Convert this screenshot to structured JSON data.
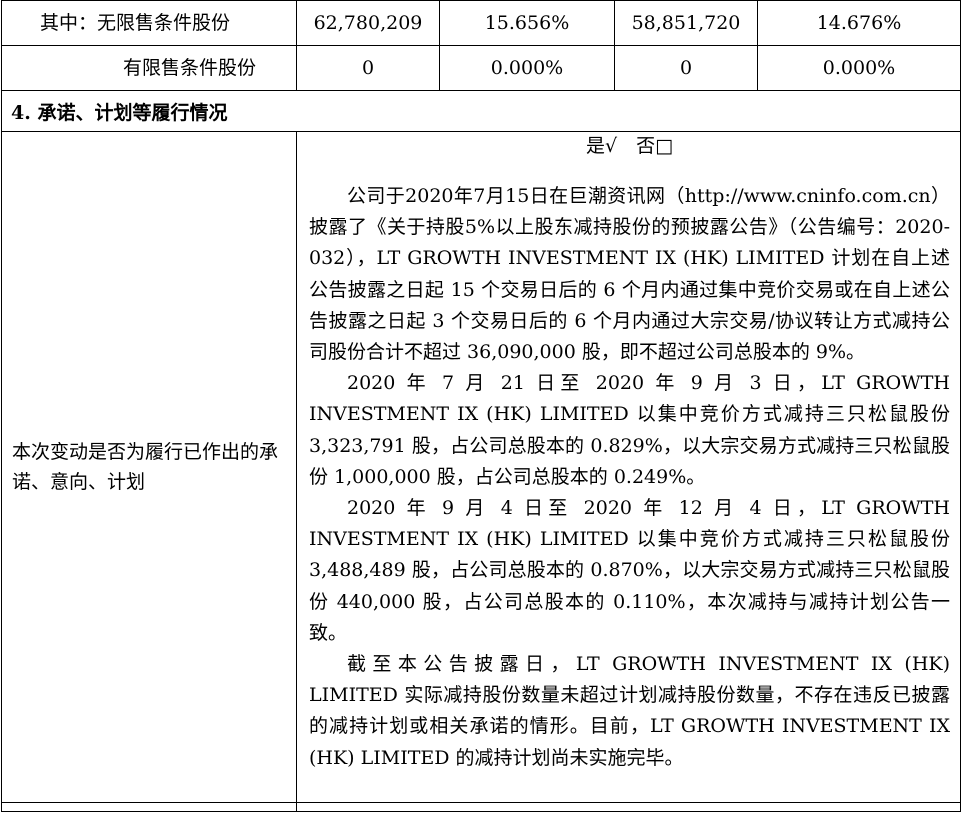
{
  "table": {
    "rows": [
      {
        "label": "其中：无限售条件股份",
        "v1": "62,780,209",
        "v2": "15.656%",
        "v3": "58,851,720",
        "v4": "14.676%"
      },
      {
        "label": "有限售条件股份",
        "v1": "0",
        "v2": "0.000%",
        "v3": "0",
        "v4": "0.000%"
      }
    ]
  },
  "section": {
    "title": "4. 承诺、计划等履行情况"
  },
  "commitment": {
    "label": "本次变动是否为履行已作出的承诺、意向、计划",
    "yes_no": "是√　否□",
    "paragraphs": [
      "公司于2020年7月15日在巨潮资讯网（http://www.cninfo.com.cn）披露了《关于持股5%以上股东减持股份的预披露公告》（公告编号：2020-032），LT GROWTH INVESTMENT IX (HK) LIMITED 计划在自上述公告披露之日起 15 个交易日后的 6 个月内通过集中竞价交易或在自上述公告披露之日起 3 个交易日后的 6 个月内通过大宗交易/协议转让方式减持公司股份合计不超过 36,090,000 股，即不超过公司总股本的 9%。",
      "2020 年 7 月 21 日至 2020 年 9 月 3 日，LT GROWTH INVESTMENT IX (HK) LIMITED 以集中竞价方式减持三只松鼠股份 3,323,791 股，占公司总股本的 0.829%，以大宗交易方式减持三只松鼠股份 1,000,000 股，占公司总股本的 0.249%。",
      "2020 年 9 月 4 日至 2020 年 12 月 4 日，LT GROWTH INVESTMENT IX (HK) LIMITED 以集中竞价方式减持三只松鼠股份 3,488,489 股，占公司总股本的 0.870%，以大宗交易方式减持三只松鼠股份 440,000 股，占公司总股本的 0.110%，本次减持与减持计划公告一致。",
      "截至本公告披露日，LT GROWTH INVESTMENT IX (HK) LIMITED 实际减持股份数量未超过计划减持股份数量，不存在违反已披露的减持计划或相关承诺的情形。目前，LT GROWTH INVESTMENT IX (HK) LIMITED 的减持计划尚未实施完毕。"
    ]
  }
}
